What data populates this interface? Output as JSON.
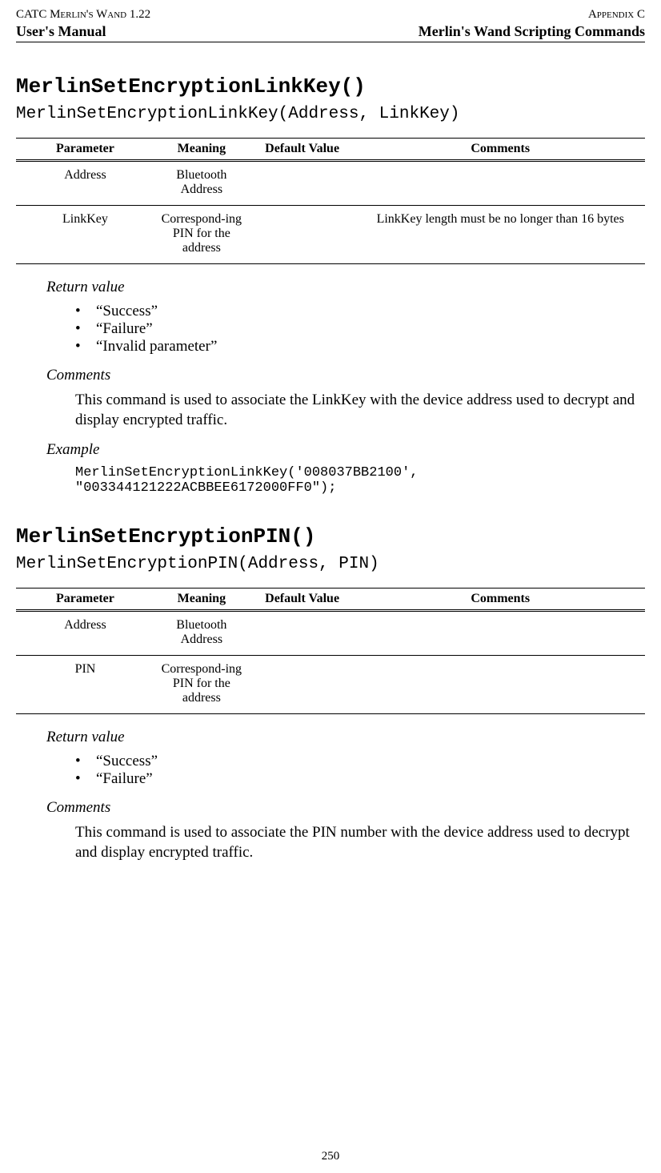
{
  "header": {
    "product": "CATC Merlin's Wand 1.22",
    "appendix": "Appendix C",
    "manual": "User's Manual",
    "subtitle": "Merlin's Wand Scripting Commands"
  },
  "sections": [
    {
      "title": "MerlinSetEncryptionLinkKey()",
      "signature": "MerlinSetEncryptionLinkKey(Address, LinkKey)",
      "table": {
        "headers": {
          "p": "Parameter",
          "m": "Meaning",
          "d": "Default Value",
          "c": "Comments"
        },
        "rows": [
          {
            "p": "Address",
            "m": "Bluetooth Address",
            "d": "",
            "c": ""
          },
          {
            "p": "LinkKey",
            "m": "Correspond-ing PIN for the address",
            "d": "",
            "c": "LinkKey length must be no longer than 16 bytes"
          }
        ]
      },
      "return_label": "Return value",
      "returns": [
        "“Success”",
        "“Failure”",
        "“Invalid parameter”"
      ],
      "comments_label": "Comments",
      "comments_body": "This command is used to associate the LinkKey with the device address used to decrypt and display encrypted traffic.",
      "example_label": "Example",
      "example_code": "MerlinSetEncryptionLinkKey('008037BB2100',\n\"003344121222ACBBEE6172000FF0\");"
    },
    {
      "title": "MerlinSetEncryptionPIN()",
      "signature": "MerlinSetEncryptionPIN(Address, PIN)",
      "table": {
        "headers": {
          "p": "Parameter",
          "m": "Meaning",
          "d": "Default Value",
          "c": "Comments"
        },
        "rows": [
          {
            "p": "Address",
            "m": "Bluetooth Address",
            "d": "",
            "c": ""
          },
          {
            "p": "PIN",
            "m": "Correspond-ing PIN for the address",
            "d": "",
            "c": ""
          }
        ]
      },
      "return_label": "Return value",
      "returns": [
        "“Success”",
        "“Failure”"
      ],
      "comments_label": "Comments",
      "comments_body": "This command is used to associate the PIN number with the device address used to decrypt and display encrypted traffic."
    }
  ],
  "page_number": "250"
}
